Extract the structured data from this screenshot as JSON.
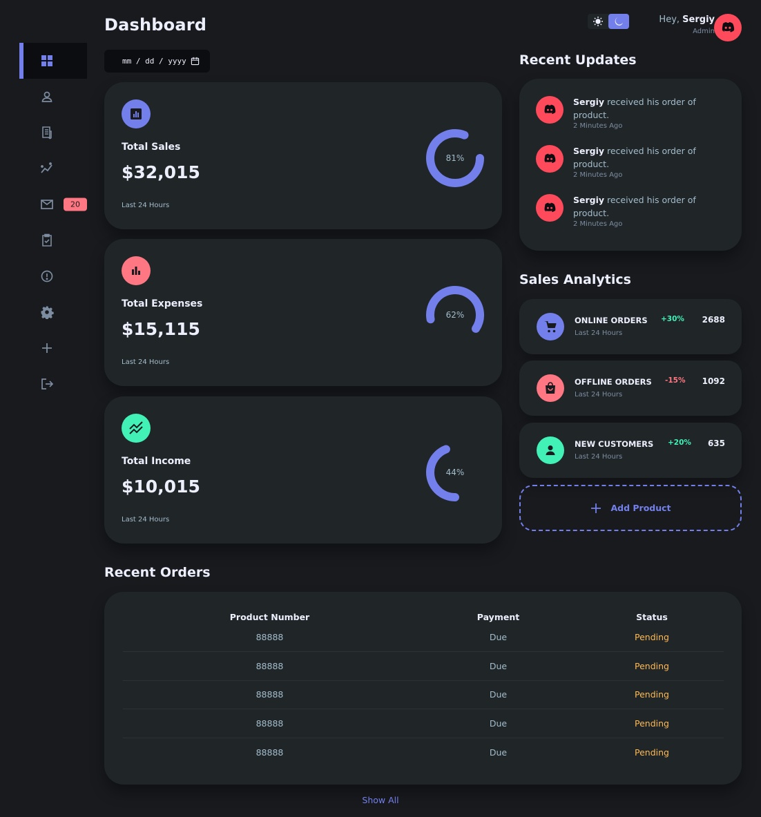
{
  "header": {
    "title": "Dashboard",
    "date_placeholder": "mm / dd / yyyy"
  },
  "profile": {
    "greeting": "Hey,",
    "name": "Sergiy",
    "role": "Admin"
  },
  "sidebar": {
    "items": [
      {
        "icon": "dashboard-icon",
        "active": true
      },
      {
        "icon": "person-icon"
      },
      {
        "icon": "receipt-icon"
      },
      {
        "icon": "insights-icon"
      },
      {
        "icon": "mail-icon",
        "badge": "20"
      },
      {
        "icon": "inventory-icon"
      },
      {
        "icon": "report-icon"
      },
      {
        "icon": "settings-icon"
      },
      {
        "icon": "add-icon"
      },
      {
        "icon": "logout-icon"
      }
    ]
  },
  "cards": [
    {
      "label": "Total Sales",
      "value": "$32,015",
      "sub": "Last 24 Hours",
      "percent_label": "81%",
      "percent": 81,
      "color": "#7380ec"
    },
    {
      "label": "Total Expenses",
      "value": "$15,115",
      "sub": "Last 24 Hours",
      "percent_label": "62%",
      "percent": 62,
      "color": "#ff7782"
    },
    {
      "label": "Total Income",
      "value": "$10,015",
      "sub": "Last 24 Hours",
      "percent_label": "44%",
      "percent": 44,
      "color": "#41f1b6"
    }
  ],
  "recent_updates": {
    "title": "Recent Updates",
    "items": [
      {
        "name": "Sergiy",
        "text": " received his order of product.",
        "time": "2 Minutes Ago"
      },
      {
        "name": "Sergiy",
        "text": " received his order of product.",
        "time": "2 Minutes Ago"
      },
      {
        "name": "Sergiy",
        "text": " received his order of product.",
        "time": "2 Minutes Ago"
      }
    ]
  },
  "sales_analytics": {
    "title": "Sales Analytics",
    "items": [
      {
        "title": "ONLINE ORDERS",
        "sub": "Last 24 Hours",
        "pct": "+30%",
        "count": "2688",
        "color": "#7380ec",
        "pct_color": "#41f1b6"
      },
      {
        "title": "OFFLINE ORDERS",
        "sub": "Last 24 Hours",
        "pct": "-15%",
        "count": "1092",
        "color": "#ff7782",
        "pct_color": "#ff7782"
      },
      {
        "title": "NEW CUSTOMERS",
        "sub": "Last 24 Hours",
        "pct": "+20%",
        "count": "635",
        "color": "#41f1b6",
        "pct_color": "#41f1b6"
      }
    ],
    "add_label": "Add Product"
  },
  "recent_orders": {
    "title": "Recent Orders",
    "columns": [
      "Product Number",
      "Payment",
      "Status"
    ],
    "rows": [
      [
        "88888",
        "Due",
        "Pending"
      ],
      [
        "88888",
        "Due",
        "Pending"
      ],
      [
        "88888",
        "Due",
        "Pending"
      ],
      [
        "88888",
        "Due",
        "Pending"
      ],
      [
        "88888",
        "Due",
        "Pending"
      ]
    ],
    "show_all": "Show All"
  },
  "colors": {
    "primary": "#7380ec",
    "danger": "#ff7782",
    "success": "#41f1b6",
    "warning": "#ffbb55",
    "background": "#181a1e",
    "card": "#202528"
  }
}
